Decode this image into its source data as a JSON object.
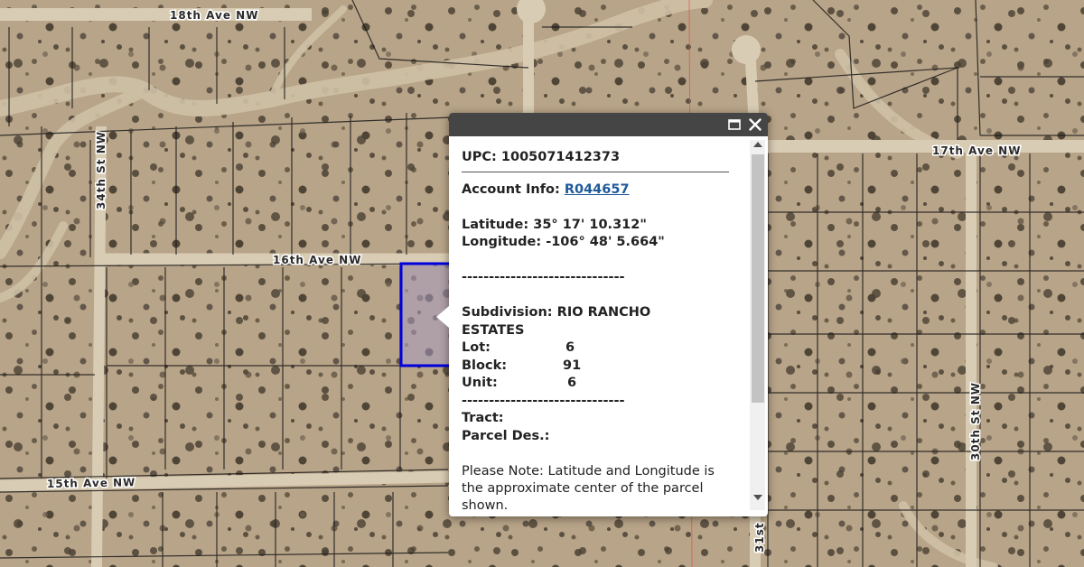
{
  "roads": {
    "ave18": "18th Ave NW",
    "ave17": "17th Ave NW",
    "ave16": "16th Ave NW",
    "ave15": "15th Ave NW",
    "st34": "34th St NW",
    "st30": "30th St NW",
    "st31": "31st"
  },
  "popup": {
    "upc": "UPC: 1005071412373",
    "account_label": "Account Info: ",
    "account_link": "R044657",
    "latitude": "Latitude: 35° 17' 10.312\"",
    "longitude": "Longitude: -106° 48' 5.664\"",
    "separator1": "------------------------------",
    "subdivision": "Subdivision: RIO RANCHO ESTATES",
    "lot_label": "Lot:",
    "lot_value": "6",
    "block_label": "Block:",
    "block_value": "91",
    "unit_label": "Unit:",
    "unit_value": "6",
    "separator2": "------------------------------",
    "tract_label": "Tract:",
    "parcel_label": "Parcel Des.:",
    "note": "Please Note: Latitude and Longitude is the approximate center of the parcel shown."
  },
  "colors": {
    "terrain": "#b8a488",
    "road": "#d8ccb4",
    "parcel_line": "#1a1a1a",
    "selection": "#0000dd",
    "popup_header": "#454545",
    "link": "#1f5a9a"
  },
  "icons": {
    "maximize": "maximize-icon",
    "close": "close-icon"
  }
}
